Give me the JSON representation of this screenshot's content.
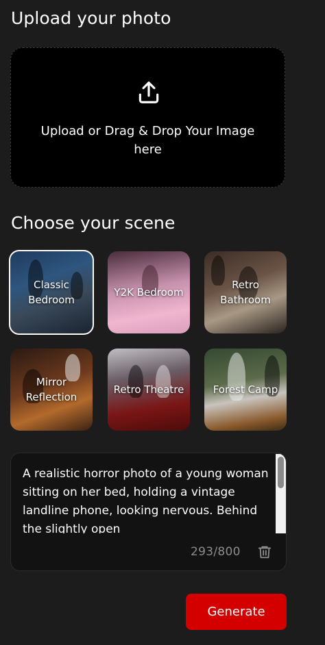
{
  "upload": {
    "title": "Upload your photo",
    "icon": "upload-icon",
    "prompt": "Upload or Drag & Drop Your Image here"
  },
  "scenes": {
    "title": "Choose your scene",
    "selected": "Classic Bedroom",
    "items": [
      {
        "label": "Classic Bedroom"
      },
      {
        "label": "Y2K Bedroom"
      },
      {
        "label": "Retro Bathroom"
      },
      {
        "label": "Mirror Reflection"
      },
      {
        "label": "Retro Theatre"
      },
      {
        "label": "Forest Camp"
      }
    ]
  },
  "prompt": {
    "text": "A realistic horror photo of a young woman sitting on her bed, holding a vintage landline phone, looking nervous. Behind the slightly open",
    "char_count": "293/800",
    "delete_icon": "trash-icon"
  },
  "actions": {
    "generate_label": "Generate"
  },
  "colors": {
    "background": "#1c1c1c",
    "upload_zone": "#000000",
    "accent": "#d40000",
    "muted_text": "#8d8d8d"
  }
}
